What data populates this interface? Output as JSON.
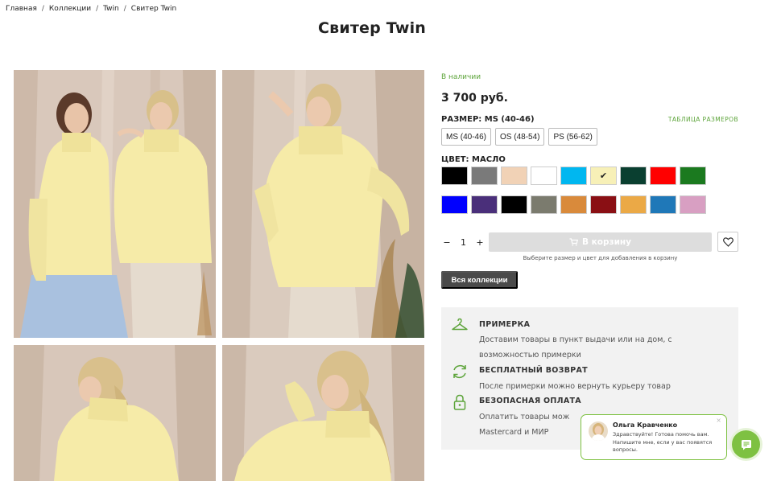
{
  "breadcrumb": {
    "items": [
      "Главная",
      "Коллекции",
      "Twin",
      "Свитер Twin"
    ],
    "separator": "/"
  },
  "product": {
    "title": "Свитер Twin",
    "stock": "В наличии",
    "price": "3 700 руб."
  },
  "size": {
    "label": "РАЗМЕР: MS (40-46)",
    "chart_link": "ТАБЛИЦА РАЗМЕРОВ",
    "options": [
      "MS (40-46)",
      "OS (48-54)",
      "PS (56-62)"
    ]
  },
  "color": {
    "label": "ЦВЕТ: МАСЛО",
    "selected_mark": "✔",
    "swatches": [
      "#000000",
      "#7a7a7a",
      "#f1d2b6",
      "#ffffff",
      "#00b7f0",
      "#f7f0b7",
      "#0a3f30",
      "#ff0000",
      "#1b7a1f",
      "#0000ff",
      "#4a2f7a",
      "#000000",
      "#7b7b6e",
      "#d98a3b",
      "#8a0f14",
      "#eba946",
      "#1f78b8",
      "#d89fc2"
    ]
  },
  "cart": {
    "minus": "−",
    "qty": "1",
    "plus": "+",
    "button_label": "В корзину",
    "hint": "Выберите размер и цвет для добавления в корзину"
  },
  "all_collections": "Вся коллекции",
  "info": [
    {
      "title": "ПРИМЕРКА",
      "lines": [
        "Доставим товары в пункт выдачи или на дом, с",
        "возможностью примерки"
      ],
      "icon": "hanger-icon"
    },
    {
      "title": "БЕСПЛАТНЫЙ ВОЗВРАТ",
      "lines": [
        "После примерки можно вернуть курьеру товар"
      ],
      "icon": "return-icon"
    },
    {
      "title": "БЕЗОПАСНАЯ ОПЛАТА",
      "lines": [
        "Оплатить товары мож",
        "Mastercard и МИР"
      ],
      "icon": "lock-icon"
    }
  ],
  "chat": {
    "name": "Ольга Кравченко",
    "message": "Здравствуйте! Готова помочь вам. Напишите мне, если у вас появятся вопросы.",
    "close": "×"
  },
  "colors": {
    "accent": "#5da43a",
    "chat_green": "#7ec142",
    "sweater": "#f6eba8"
  }
}
